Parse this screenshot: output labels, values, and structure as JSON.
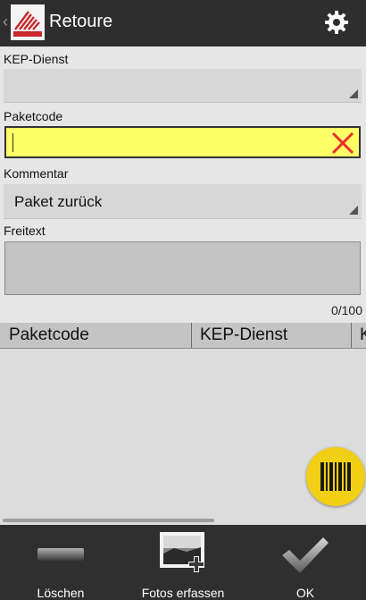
{
  "titlebar": {
    "title": "Retoure",
    "back_glyph": "‹",
    "logo_icon": "coopo-logo-icon",
    "settings_icon": "gear-icon"
  },
  "form": {
    "kep_dienst": {
      "label": "KEP-Dienst",
      "value": ""
    },
    "paketcode": {
      "label": "Paketcode",
      "value": "",
      "background": "#ffff66",
      "clear_icon": "close-icon",
      "clear_color": "#e8322b"
    },
    "kommentar": {
      "label": "Kommentar",
      "value": "Paket zurück"
    },
    "freitext": {
      "label": "Freitext",
      "value": "",
      "counter": "0/100"
    }
  },
  "table": {
    "columns": [
      "Paketcode",
      "KEP-Dienst",
      "K"
    ],
    "rows": []
  },
  "scan_button": {
    "icon": "barcode-icon",
    "color": "#f0cf14"
  },
  "bottom_bar": {
    "actions": [
      {
        "label": "Löschen",
        "icon": "minus-icon"
      },
      {
        "label": "Fotos erfassen",
        "icon": "add-photo-icon"
      },
      {
        "label": "OK",
        "icon": "checkmark-icon"
      }
    ]
  }
}
